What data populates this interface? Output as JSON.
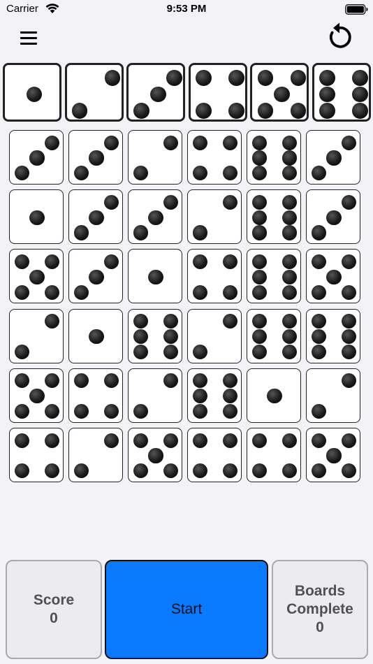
{
  "status_bar": {
    "carrier": "Carrier",
    "time": "9:53 PM"
  },
  "header": {
    "menu_icon": "hamburger-menu-icon",
    "refresh_icon": "refresh-icon"
  },
  "target_row": [
    1,
    2,
    3,
    4,
    5,
    6
  ],
  "board": [
    [
      3,
      3,
      2,
      4,
      6,
      3
    ],
    [
      1,
      3,
      3,
      2,
      6,
      3
    ],
    [
      5,
      3,
      1,
      4,
      6,
      5
    ],
    [
      2,
      1,
      6,
      2,
      6,
      6
    ],
    [
      5,
      4,
      2,
      6,
      1,
      2
    ],
    [
      4,
      2,
      5,
      4,
      4,
      5
    ]
  ],
  "footer": {
    "score_label": "Score",
    "score_value": "0",
    "start_label": "Start",
    "boards_label_line1": "Boards",
    "boards_label_line2": "Complete",
    "boards_value": "0"
  },
  "colors": {
    "background": "#f2f2f7",
    "start_button": "#0a7aff",
    "panel": "#ebebf0",
    "panel_text": "#505055"
  }
}
